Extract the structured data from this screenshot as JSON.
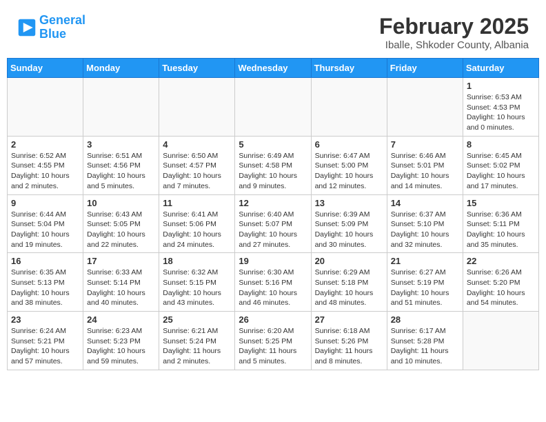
{
  "header": {
    "logo_line1": "General",
    "logo_line2": "Blue",
    "title": "February 2025",
    "subtitle": "Iballe, Shkoder County, Albania"
  },
  "calendar": {
    "days_of_week": [
      "Sunday",
      "Monday",
      "Tuesday",
      "Wednesday",
      "Thursday",
      "Friday",
      "Saturday"
    ],
    "weeks": [
      [
        {
          "day": "",
          "info": ""
        },
        {
          "day": "",
          "info": ""
        },
        {
          "day": "",
          "info": ""
        },
        {
          "day": "",
          "info": ""
        },
        {
          "day": "",
          "info": ""
        },
        {
          "day": "",
          "info": ""
        },
        {
          "day": "1",
          "info": "Sunrise: 6:53 AM\nSunset: 4:53 PM\nDaylight: 10 hours\nand 0 minutes."
        }
      ],
      [
        {
          "day": "2",
          "info": "Sunrise: 6:52 AM\nSunset: 4:55 PM\nDaylight: 10 hours\nand 2 minutes."
        },
        {
          "day": "3",
          "info": "Sunrise: 6:51 AM\nSunset: 4:56 PM\nDaylight: 10 hours\nand 5 minutes."
        },
        {
          "day": "4",
          "info": "Sunrise: 6:50 AM\nSunset: 4:57 PM\nDaylight: 10 hours\nand 7 minutes."
        },
        {
          "day": "5",
          "info": "Sunrise: 6:49 AM\nSunset: 4:58 PM\nDaylight: 10 hours\nand 9 minutes."
        },
        {
          "day": "6",
          "info": "Sunrise: 6:47 AM\nSunset: 5:00 PM\nDaylight: 10 hours\nand 12 minutes."
        },
        {
          "day": "7",
          "info": "Sunrise: 6:46 AM\nSunset: 5:01 PM\nDaylight: 10 hours\nand 14 minutes."
        },
        {
          "day": "8",
          "info": "Sunrise: 6:45 AM\nSunset: 5:02 PM\nDaylight: 10 hours\nand 17 minutes."
        }
      ],
      [
        {
          "day": "9",
          "info": "Sunrise: 6:44 AM\nSunset: 5:04 PM\nDaylight: 10 hours\nand 19 minutes."
        },
        {
          "day": "10",
          "info": "Sunrise: 6:43 AM\nSunset: 5:05 PM\nDaylight: 10 hours\nand 22 minutes."
        },
        {
          "day": "11",
          "info": "Sunrise: 6:41 AM\nSunset: 5:06 PM\nDaylight: 10 hours\nand 24 minutes."
        },
        {
          "day": "12",
          "info": "Sunrise: 6:40 AM\nSunset: 5:07 PM\nDaylight: 10 hours\nand 27 minutes."
        },
        {
          "day": "13",
          "info": "Sunrise: 6:39 AM\nSunset: 5:09 PM\nDaylight: 10 hours\nand 30 minutes."
        },
        {
          "day": "14",
          "info": "Sunrise: 6:37 AM\nSunset: 5:10 PM\nDaylight: 10 hours\nand 32 minutes."
        },
        {
          "day": "15",
          "info": "Sunrise: 6:36 AM\nSunset: 5:11 PM\nDaylight: 10 hours\nand 35 minutes."
        }
      ],
      [
        {
          "day": "16",
          "info": "Sunrise: 6:35 AM\nSunset: 5:13 PM\nDaylight: 10 hours\nand 38 minutes."
        },
        {
          "day": "17",
          "info": "Sunrise: 6:33 AM\nSunset: 5:14 PM\nDaylight: 10 hours\nand 40 minutes."
        },
        {
          "day": "18",
          "info": "Sunrise: 6:32 AM\nSunset: 5:15 PM\nDaylight: 10 hours\nand 43 minutes."
        },
        {
          "day": "19",
          "info": "Sunrise: 6:30 AM\nSunset: 5:16 PM\nDaylight: 10 hours\nand 46 minutes."
        },
        {
          "day": "20",
          "info": "Sunrise: 6:29 AM\nSunset: 5:18 PM\nDaylight: 10 hours\nand 48 minutes."
        },
        {
          "day": "21",
          "info": "Sunrise: 6:27 AM\nSunset: 5:19 PM\nDaylight: 10 hours\nand 51 minutes."
        },
        {
          "day": "22",
          "info": "Sunrise: 6:26 AM\nSunset: 5:20 PM\nDaylight: 10 hours\nand 54 minutes."
        }
      ],
      [
        {
          "day": "23",
          "info": "Sunrise: 6:24 AM\nSunset: 5:21 PM\nDaylight: 10 hours\nand 57 minutes."
        },
        {
          "day": "24",
          "info": "Sunrise: 6:23 AM\nSunset: 5:23 PM\nDaylight: 10 hours\nand 59 minutes."
        },
        {
          "day": "25",
          "info": "Sunrise: 6:21 AM\nSunset: 5:24 PM\nDaylight: 11 hours\nand 2 minutes."
        },
        {
          "day": "26",
          "info": "Sunrise: 6:20 AM\nSunset: 5:25 PM\nDaylight: 11 hours\nand 5 minutes."
        },
        {
          "day": "27",
          "info": "Sunrise: 6:18 AM\nSunset: 5:26 PM\nDaylight: 11 hours\nand 8 minutes."
        },
        {
          "day": "28",
          "info": "Sunrise: 6:17 AM\nSunset: 5:28 PM\nDaylight: 11 hours\nand 10 minutes."
        },
        {
          "day": "",
          "info": ""
        }
      ]
    ]
  }
}
